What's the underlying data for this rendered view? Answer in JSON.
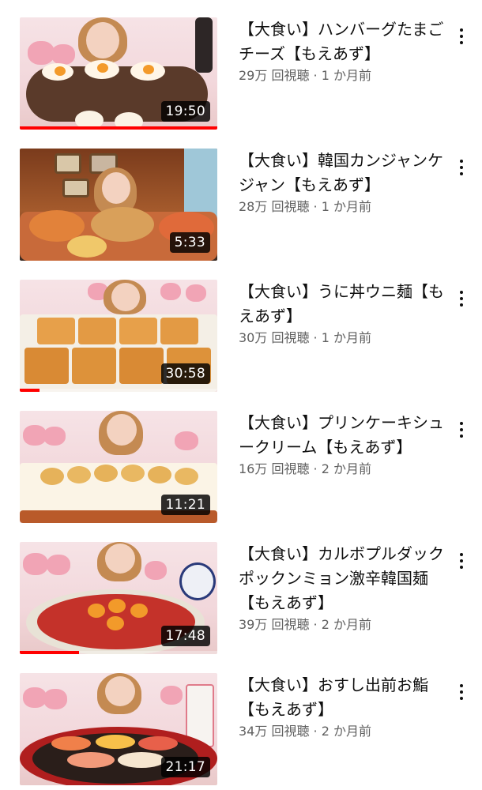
{
  "videos": [
    {
      "title": "【大食い】ハンバーグたまごチーズ【もえあず】",
      "views": "29万 回視聴",
      "age": "1 か月前",
      "duration": "19:50",
      "progress": 1.0
    },
    {
      "title": "【大食い】韓国カンジャンケジャン【もえあず】",
      "views": "28万 回視聴",
      "age": "1 か月前",
      "duration": "5:33",
      "progress": 0
    },
    {
      "title": "【大食い】うに丼ウニ麺【もえあず】",
      "views": "30万 回視聴",
      "age": "1 か月前",
      "duration": "30:58",
      "progress": 0.1
    },
    {
      "title": "【大食い】プリンケーキシュークリーム【もえあず】",
      "views": "16万 回視聴",
      "age": "2 か月前",
      "duration": "11:21",
      "progress": 0
    },
    {
      "title": "【大食い】カルボプルダックポックンミョン激辛韓国麺【もえあず】",
      "views": "39万 回視聴",
      "age": "2 か月前",
      "duration": "17:48",
      "progress": 0.3
    },
    {
      "title": "【大食い】おすし出前お鮨【もえあず】",
      "views": "34万 回視聴",
      "age": "2 か月前",
      "duration": "21:17",
      "progress": 0
    }
  ],
  "separator": " · ",
  "colors": {
    "progress": "#ff0000",
    "meta_text": "#606060",
    "title_text": "#0f0f0f"
  },
  "icons": {
    "more": "more-vertical-icon"
  }
}
